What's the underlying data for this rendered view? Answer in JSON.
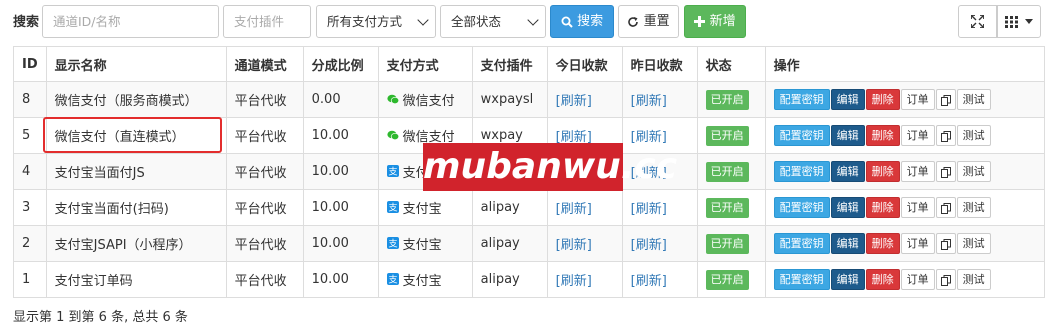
{
  "toolbar": {
    "search_label": "搜索",
    "channel_placeholder": "通道ID/名称",
    "plugin_placeholder": "支付插件",
    "pay_type_select": "所有支付方式",
    "status_select": "全部状态",
    "search_button": "搜索",
    "reset_button": "重置",
    "add_button": "新增"
  },
  "table": {
    "headers": [
      "ID",
      "显示名称",
      "通道模式",
      "分成比例",
      "支付方式",
      "支付插件",
      "今日收款",
      "昨日收款",
      "状态",
      "操作"
    ],
    "rows": [
      {
        "id": "8",
        "name": "微信支付（服务商模式）",
        "mode": "平台代收",
        "rate": "0.00",
        "pay_type": "微信支付",
        "pay_icon": "wechat-pay-icon",
        "plugin": "wxpaysl",
        "today": "[刷新]",
        "yesterday": "[刷新]",
        "status": "已开启"
      },
      {
        "id": "5",
        "name": "微信支付（直连模式）",
        "mode": "平台代收",
        "rate": "10.00",
        "pay_type": "微信支付",
        "pay_icon": "wechat-pay-icon",
        "plugin": "wxpay",
        "today": "[刷新]",
        "yesterday": "[刷新]",
        "status": "已开启"
      },
      {
        "id": "4",
        "name": "支付宝当面付JS",
        "mode": "平台代收",
        "rate": "10.00",
        "pay_type": "支付宝",
        "pay_icon": "alipay-icon",
        "plugin": "alipay",
        "today": "[刷新]",
        "yesterday": "[刷新]",
        "status": "已开启"
      },
      {
        "id": "3",
        "name": "支付宝当面付(扫码)",
        "mode": "平台代收",
        "rate": "10.00",
        "pay_type": "支付宝",
        "pay_icon": "alipay-icon",
        "plugin": "alipay",
        "today": "[刷新]",
        "yesterday": "[刷新]",
        "status": "已开启"
      },
      {
        "id": "2",
        "name": "支付宝JSAPI（小程序）",
        "mode": "平台代收",
        "rate": "10.00",
        "pay_type": "支付宝",
        "pay_icon": "alipay-icon",
        "plugin": "alipay",
        "today": "[刷新]",
        "yesterday": "[刷新]",
        "status": "已开启"
      },
      {
        "id": "1",
        "name": "支付宝订单码",
        "mode": "平台代收",
        "rate": "10.00",
        "pay_type": "支付宝",
        "pay_icon": "alipay-icon",
        "plugin": "alipay",
        "today": "[刷新]",
        "yesterday": "[刷新]",
        "status": "已开启"
      }
    ],
    "actions": {
      "config": "配置密钥",
      "edit": "编辑",
      "delete": "删除",
      "order": "订单",
      "test": "测试"
    }
  },
  "footer": {
    "summary": "显示第 1 到第 6 条, 总共 6 条"
  },
  "watermark": "mubanwu.cc",
  "colors": {
    "primary": "#3c9be0",
    "success": "#5cb85c",
    "danger": "#d9383a",
    "edit": "#1e5b8c",
    "highlight": "#e32d2d",
    "watermark": "#d1232c"
  }
}
